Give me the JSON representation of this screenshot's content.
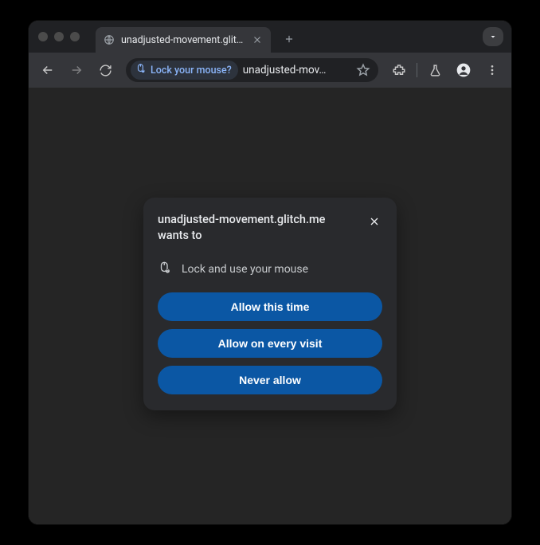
{
  "tab": {
    "title": "unadjusted-movement.glitch."
  },
  "omnibox": {
    "chip_label": "Lock your mouse?",
    "url_text": "unadjusted-mov…"
  },
  "dialog": {
    "title": "unadjusted-movement.glitch.me wants to",
    "permission_label": "Lock and use your mouse",
    "buttons": {
      "allow_once": "Allow this time",
      "allow_always": "Allow on every visit",
      "never": "Never allow"
    }
  }
}
